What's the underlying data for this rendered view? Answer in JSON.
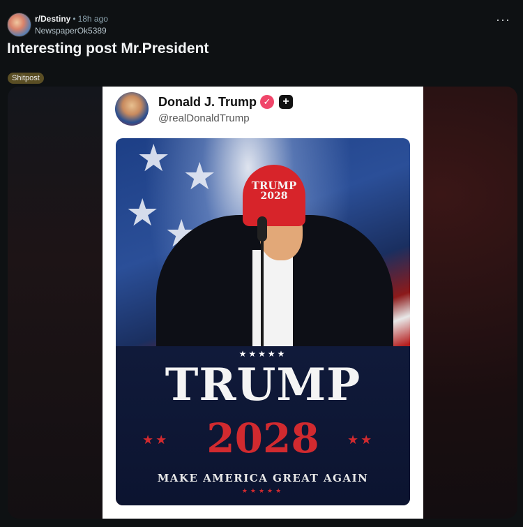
{
  "header": {
    "subreddit": "r/Destiny",
    "separator": "•",
    "age": "18h ago",
    "username": "NewspaperOk5389",
    "more_label": "···"
  },
  "post": {
    "title": "Interesting post Mr.President",
    "flair": "Shitpost"
  },
  "embedded_post": {
    "name": "Donald J. Trump",
    "verified_icon": "✓",
    "plus_icon": "+",
    "handle": "@realDonaldTrump",
    "poster": {
      "cap_line1": "TRUMP",
      "cap_line2": "2028",
      "top_stars": "★★★★★",
      "headline": "TRUMP",
      "year": "2028",
      "side_stars": "★★",
      "slogan": "MAKE AMERICA GREAT AGAIN",
      "bottom_stars": "★★★★★"
    }
  },
  "colors": {
    "background": "#0e1113",
    "flair": "#5a4e24",
    "accent_red": "#d12a2f",
    "navy": "#101a3a"
  }
}
